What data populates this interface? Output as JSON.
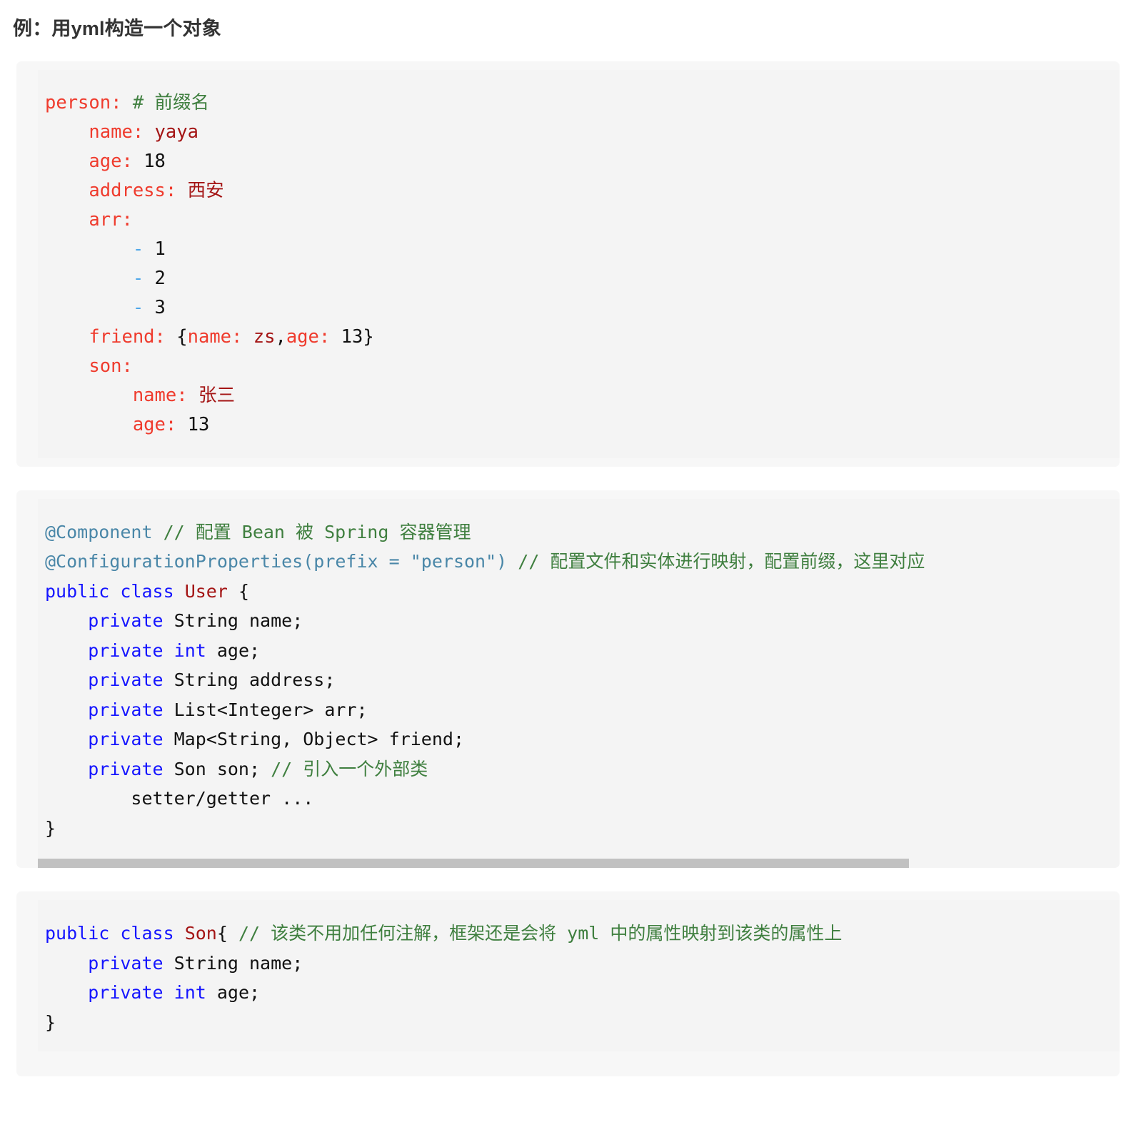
{
  "page": {
    "title": "例：用yml构造一个对象"
  },
  "blocks": {
    "yaml": {
      "language": "yaml",
      "lines": [
        {
          "indent": 0,
          "tokens": [
            {
              "t": "key",
              "v": "person:"
            },
            {
              "t": "plain",
              "v": " "
            },
            {
              "t": "comment",
              "v": "# 前缀名"
            }
          ]
        },
        {
          "indent": 1,
          "tokens": [
            {
              "t": "key",
              "v": "name:"
            },
            {
              "t": "plain",
              "v": " "
            },
            {
              "t": "str",
              "v": "yaya"
            }
          ]
        },
        {
          "indent": 1,
          "tokens": [
            {
              "t": "key",
              "v": "age:"
            },
            {
              "t": "plain",
              "v": " "
            },
            {
              "t": "num",
              "v": "18"
            }
          ]
        },
        {
          "indent": 1,
          "tokens": [
            {
              "t": "key",
              "v": "address:"
            },
            {
              "t": "plain",
              "v": " "
            },
            {
              "t": "str",
              "v": "西安"
            }
          ]
        },
        {
          "indent": 1,
          "tokens": [
            {
              "t": "key",
              "v": "arr:"
            }
          ]
        },
        {
          "indent": 2,
          "tokens": [
            {
              "t": "dash",
              "v": "-"
            },
            {
              "t": "plain",
              "v": " "
            },
            {
              "t": "num",
              "v": "1"
            }
          ]
        },
        {
          "indent": 2,
          "tokens": [
            {
              "t": "dash",
              "v": "-"
            },
            {
              "t": "plain",
              "v": " "
            },
            {
              "t": "num",
              "v": "2"
            }
          ]
        },
        {
          "indent": 2,
          "tokens": [
            {
              "t": "dash",
              "v": "-"
            },
            {
              "t": "plain",
              "v": " "
            },
            {
              "t": "num",
              "v": "3"
            }
          ]
        },
        {
          "indent": 1,
          "tokens": [
            {
              "t": "key",
              "v": "friend:"
            },
            {
              "t": "plain",
              "v": " "
            },
            {
              "t": "punc",
              "v": "{"
            },
            {
              "t": "key",
              "v": "name:"
            },
            {
              "t": "plain",
              "v": " "
            },
            {
              "t": "str",
              "v": "zs"
            },
            {
              "t": "punc",
              "v": ","
            },
            {
              "t": "key",
              "v": "age:"
            },
            {
              "t": "plain",
              "v": " "
            },
            {
              "t": "num",
              "v": "13"
            },
            {
              "t": "punc",
              "v": "}"
            }
          ]
        },
        {
          "indent": 1,
          "tokens": [
            {
              "t": "key",
              "v": "son:"
            }
          ]
        },
        {
          "indent": 2,
          "tokens": [
            {
              "t": "key",
              "v": "name:"
            },
            {
              "t": "plain",
              "v": " "
            },
            {
              "t": "str",
              "v": "张三"
            }
          ]
        },
        {
          "indent": 2,
          "tokens": [
            {
              "t": "key",
              "v": "age:"
            },
            {
              "t": "plain",
              "v": " "
            },
            {
              "t": "num",
              "v": "13"
            }
          ]
        }
      ],
      "plain_text": "person: # 前缀名\n  name: yaya\n  age: 18\n  address: 西安\n  arr:\n    - 1\n    - 2\n    - 3\n  friend: {name: zs,age: 13}\n  son:\n    name: 张三\n    age: 13"
    },
    "user_class": {
      "language": "java",
      "lines": [
        {
          "indent": 0,
          "tokens": [
            {
              "t": "anno",
              "v": "@Component"
            },
            {
              "t": "plain",
              "v": " "
            },
            {
              "t": "comment",
              "v": "// 配置 Bean 被 Spring 容器管理"
            }
          ]
        },
        {
          "indent": 0,
          "tokens": [
            {
              "t": "anno",
              "v": "@ConfigurationProperties(prefix = \"person\")"
            },
            {
              "t": "plain",
              "v": " "
            },
            {
              "t": "comment",
              "v": "// 配置文件和实体进行映射，配置前缀，这里对应"
            }
          ]
        },
        {
          "indent": 0,
          "tokens": [
            {
              "t": "kw",
              "v": "public class"
            },
            {
              "t": "plain",
              "v": " "
            },
            {
              "t": "type",
              "v": "User"
            },
            {
              "t": "plain",
              "v": " {"
            }
          ]
        },
        {
          "indent": 1,
          "tokens": [
            {
              "t": "kw",
              "v": "private"
            },
            {
              "t": "plain",
              "v": " String name;"
            }
          ]
        },
        {
          "indent": 1,
          "tokens": [
            {
              "t": "kw",
              "v": "private"
            },
            {
              "t": "plain",
              "v": " "
            },
            {
              "t": "kw",
              "v": "int"
            },
            {
              "t": "plain",
              "v": " age;"
            }
          ]
        },
        {
          "indent": 1,
          "tokens": [
            {
              "t": "kw",
              "v": "private"
            },
            {
              "t": "plain",
              "v": " String address;"
            }
          ]
        },
        {
          "indent": 1,
          "tokens": [
            {
              "t": "kw",
              "v": "private"
            },
            {
              "t": "plain",
              "v": " List<Integer> arr;"
            }
          ]
        },
        {
          "indent": 1,
          "tokens": [
            {
              "t": "kw",
              "v": "private"
            },
            {
              "t": "plain",
              "v": " Map<String, Object> friend;"
            }
          ]
        },
        {
          "indent": 1,
          "tokens": [
            {
              "t": "kw",
              "v": "private"
            },
            {
              "t": "plain",
              "v": " Son son; "
            },
            {
              "t": "comment",
              "v": "// 引入一个外部类"
            }
          ]
        },
        {
          "indent": 2,
          "tokens": [
            {
              "t": "plain",
              "v": "setter/getter ..."
            }
          ]
        },
        {
          "indent": 0,
          "tokens": [
            {
              "t": "plain",
              "v": "}"
            }
          ]
        }
      ],
      "plain_text": "@Component // 配置 Bean 被 Spring 容器管理\n@ConfigurationProperties(prefix = \"person\") // 配置文件和实体进行映射，配置前缀，这里对应\npublic class User {\n    private String name;\n    private int age;\n    private String address;\n    private List<Integer> arr;\n    private Map<String, Object> friend;\n    private Son son; // 引入一个外部类\n        setter/getter ...\n}",
      "scrollbar": {
        "visible": true,
        "thumb_width_percent": "80.5%"
      }
    },
    "son_class": {
      "language": "java",
      "lines": [
        {
          "indent": 0,
          "tokens": [
            {
              "t": "kw",
              "v": "public class"
            },
            {
              "t": "plain",
              "v": " "
            },
            {
              "t": "type",
              "v": "Son"
            },
            {
              "t": "plain",
              "v": "{ "
            },
            {
              "t": "comment",
              "v": "// 该类不用加任何注解，框架还是会将 yml 中的属性映射到该类的属性上"
            }
          ]
        },
        {
          "indent": 1,
          "tokens": [
            {
              "t": "kw",
              "v": "private"
            },
            {
              "t": "plain",
              "v": " String name;"
            }
          ]
        },
        {
          "indent": 1,
          "tokens": [
            {
              "t": "kw",
              "v": "private"
            },
            {
              "t": "plain",
              "v": " "
            },
            {
              "t": "kw",
              "v": "int"
            },
            {
              "t": "plain",
              "v": " age;"
            }
          ]
        },
        {
          "indent": 0,
          "tokens": [
            {
              "t": "plain",
              "v": "}"
            }
          ]
        }
      ],
      "plain_text": "public class Son{ // 该类不用加任何注解，框架还是会将 yml 中的属性映射到该类的属性上\n    private String name;\n    private int age;\n}"
    }
  },
  "colors": {
    "page_background": "#ffffff",
    "block_background": "#f7f7f7",
    "code_background": "#f4f4f4",
    "title": "#333333",
    "yaml_key": "#ef3b2d",
    "yaml_string": "#a41515",
    "comment": "#3f7f3f",
    "list_dash": "#4da6e8",
    "java_annotation": "#4a87a8",
    "java_keyword": "#1515ff",
    "java_type": "#a41515",
    "scrollbar_thumb": "#c1c1c1"
  }
}
